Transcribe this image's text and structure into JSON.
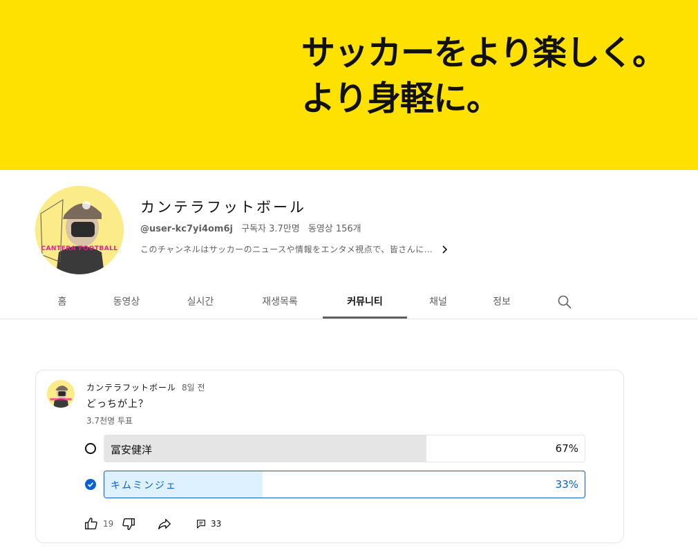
{
  "banner": {
    "line1": "サッカーをより楽しく。",
    "line2": "より身軽に。",
    "color": "#ffe100"
  },
  "channel": {
    "avatar_text": "CANTERA FOOTBALL",
    "title": "カンテラフットボール",
    "handle": "@user-kc7yi4om6j",
    "subscribers": "구독자 3.7만명",
    "videos": "동영상 156개",
    "description": "このチャンネルはサッカーのニュースや情報をエンタメ視点で、皆さんに…",
    "description_icon": "chevron-right-icon"
  },
  "tabs": [
    {
      "label": "홈",
      "active": false
    },
    {
      "label": "동영상",
      "active": false
    },
    {
      "label": "실시간",
      "active": false
    },
    {
      "label": "재생목록",
      "active": false
    },
    {
      "label": "커뮤니티",
      "active": true
    },
    {
      "label": "채널",
      "active": false
    },
    {
      "label": "정보",
      "active": false
    }
  ],
  "search_icon": "search-icon",
  "post": {
    "author": "カンテラフットボール",
    "time": "8일 전",
    "text": "どっちが上？",
    "vote_count": "3.7천명 투표",
    "options": [
      {
        "label": "冨安健洋",
        "percent_label": "67%",
        "percent": 67,
        "selected": false
      },
      {
        "label": "キムミンジェ",
        "percent_label": "33%",
        "percent": 33,
        "selected": true
      }
    ],
    "likes": "19",
    "comments": "33",
    "accent": "#065fd4"
  }
}
